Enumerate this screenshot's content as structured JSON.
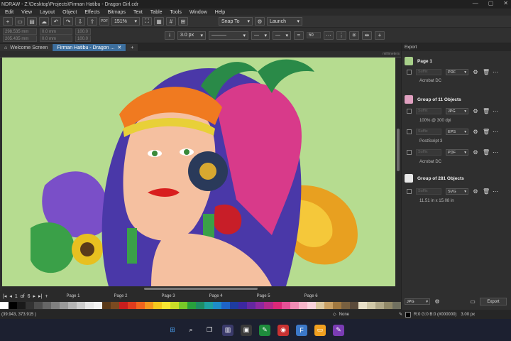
{
  "window": {
    "title": "NDRAW - Z:\\Desktop\\Projects\\Firman Hatibu - Dragon Girl.cdr",
    "min": "—",
    "max": "▢",
    "close": "✕"
  },
  "menu": [
    "Edit",
    "View",
    "Layout",
    "Object",
    "Effects",
    "Bitmaps",
    "Text",
    "Table",
    "Tools",
    "Window",
    "Help"
  ],
  "toolbar": {
    "zoom": "151%",
    "snap": "Snap To",
    "launch": "Launch",
    "pdf_label": "PDF"
  },
  "propbar": {
    "x": "298.535 mm",
    "y": "205.435 mm",
    "w": "0.0 mm",
    "h": "0.0 mm",
    "sx": "100.0",
    "sy": "100.0",
    "outline": "3.0 px",
    "val": "50"
  },
  "tabs": [
    {
      "label": "Welcome Screen"
    },
    {
      "label": "Firman Hatibu - Dragon ..."
    }
  ],
  "ruler": {
    "unit": "millimeters"
  },
  "pages": {
    "current": "1",
    "of": "of",
    "total": "6",
    "list": [
      "Page 1",
      "Page 2",
      "Page 3",
      "Page 4",
      "Page 5",
      "Page 6"
    ]
  },
  "status": {
    "coords": "(39.943, 373.915 )",
    "fill": "None",
    "color": "R:0 G:0 B:0 (#000000)",
    "outline": "3.00 px"
  },
  "docker": {
    "title": "Export",
    "groups": [
      {
        "name": "Page 1",
        "rows": [
          {
            "suffix": "Suffix",
            "format": "PDF",
            "sub": "Acrobat DC"
          }
        ]
      },
      {
        "name": "Group of 11 Objects",
        "rows": [
          {
            "suffix": "Suffix",
            "format": "JPG",
            "sub": "100% @ 300 dpi"
          },
          {
            "suffix": "Suffix",
            "format": "EPS",
            "sub": "PostScript 3"
          },
          {
            "suffix": "Suffix",
            "format": "PDF",
            "sub": "Acrobat DC"
          }
        ]
      },
      {
        "name": "Group of 281 Objects",
        "rows": [
          {
            "suffix": "Suffix",
            "format": "SVG",
            "sub": "11.51 in x 15.08 in"
          }
        ]
      }
    ],
    "bottom_format": "JPG",
    "export_label": "Export"
  },
  "icons": [
    "gear-icon",
    "trash-icon",
    "more-icon",
    "windows-start-icon",
    "search-icon"
  ],
  "palette": [
    "#ffffff",
    "#000000",
    "#1a1a1a",
    "#333333",
    "#4d4d4d",
    "#666666",
    "#808080",
    "#999999",
    "#b3b3b3",
    "#cccccc",
    "#e6e6e6",
    "#f2f2f2",
    "#5a3a1a",
    "#7a4a20",
    "#c81e1e",
    "#e03c1e",
    "#f0641e",
    "#f5961e",
    "#f5c81e",
    "#fae632",
    "#c8dc28",
    "#78c828",
    "#28a03c",
    "#1e8c64",
    "#1ea0a0",
    "#1e8cc8",
    "#1e64c8",
    "#1e3ca0",
    "#3c28a0",
    "#6428a0",
    "#8c28a0",
    "#b4288c",
    "#dc2878",
    "#e65096",
    "#f08cb4",
    "#f5b4c8",
    "#fad2dc",
    "#dcc8a0",
    "#c8a064",
    "#a07840",
    "#786040",
    "#5a4a3a",
    "#e8e0c8",
    "#d0c8a8",
    "#b0a888",
    "#908868",
    "#707060"
  ]
}
